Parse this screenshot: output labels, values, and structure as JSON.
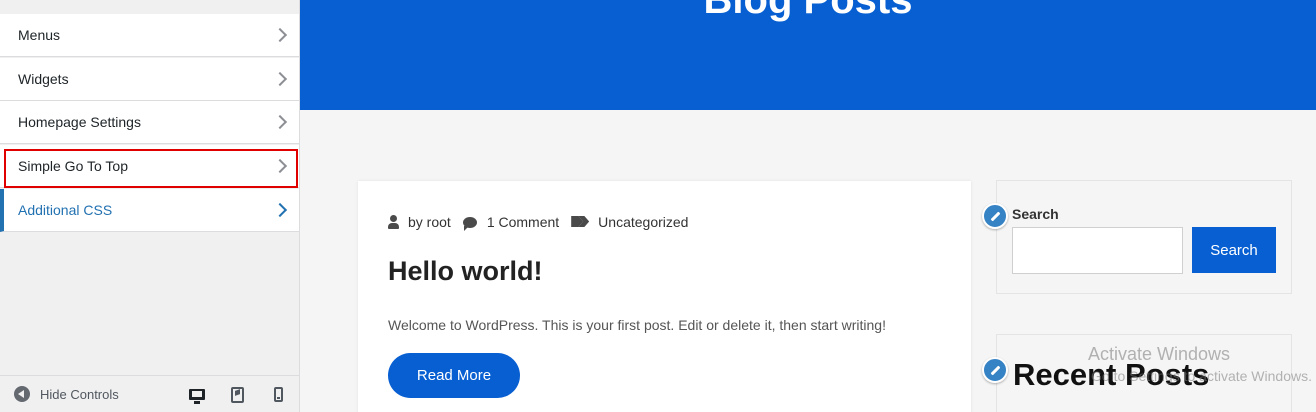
{
  "sidebar": {
    "items": [
      {
        "label": "Menus"
      },
      {
        "label": "Widgets"
      },
      {
        "label": "Homepage Settings"
      },
      {
        "label": "Simple Go To Top"
      },
      {
        "label": "Additional CSS"
      }
    ],
    "footer": {
      "hide_controls": "Hide Controls",
      "devices": [
        "desktop-icon",
        "tablet-icon",
        "mobile-icon"
      ]
    }
  },
  "preview": {
    "hero_title": "Blog Posts",
    "post": {
      "author": "by root",
      "comments": "1 Comment",
      "category": "Uncategorized",
      "title": "Hello world!",
      "excerpt": "Welcome to WordPress. This is your first post. Edit or delete it, then start writing!",
      "read_more": "Read More"
    },
    "search_widget": {
      "label": "Search",
      "value": "",
      "button": "Search"
    },
    "recent_widget": {
      "title": "Recent Posts"
    },
    "watermark": {
      "line1": "Activate Windows",
      "line2": "Go to Settings to activate Windows."
    }
  },
  "colors": {
    "brand_blue": "#075fd2",
    "wp_active": "#2271b1",
    "highlight_red": "#e00000"
  }
}
